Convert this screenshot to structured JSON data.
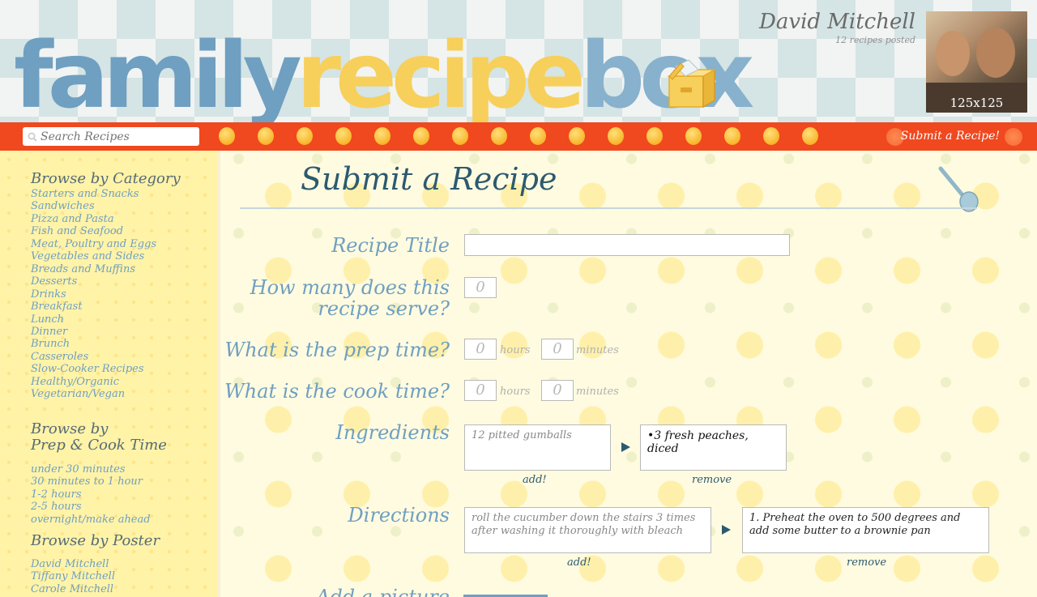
{
  "header": {
    "logo_family": "family",
    "logo_recipe": "recipe",
    "logo_box": "box",
    "username": "David Mitchell",
    "recipe_count": "12 recipes posted",
    "avatar_label": "125x125"
  },
  "navbar": {
    "search_placeholder": "Search Recipes",
    "search_dims": "218x23",
    "submit_link": "Submit a Recipe!"
  },
  "sidebar": {
    "category_title": "Browse by Category",
    "categories": [
      "Starters and Snacks",
      "Sandwiches",
      "Pizza and Pasta",
      "Fish and Seafood",
      "Meat, Poultry and Eggs",
      "Vegetables and Sides",
      "Breads and Muffins",
      "Desserts",
      "Drinks",
      "Breakfast",
      "Lunch",
      "Dinner",
      "Brunch",
      "Casseroles",
      "Slow-Cooker Recipes",
      "Healthy/Organic",
      "Vegetarian/Vegan"
    ],
    "time_title_1": "Browse by",
    "time_title_2": "Prep & Cook Time",
    "times": [
      "under 30 minutes",
      "30 minutes to 1 hour",
      "1-2 hours",
      "2-5 hours",
      "overnight/make ahead"
    ],
    "poster_title": "Browse by Poster",
    "posters": [
      "David Mitchell",
      "Tiffany Mitchell",
      "Carole Mitchell"
    ]
  },
  "form": {
    "page_title": "Submit a Recipe",
    "title_label": "Recipe Title",
    "serves_label_1": "How many does this",
    "serves_label_2": "recipe serve?",
    "serves_value": "0",
    "prep_label": "What is the prep time?",
    "cook_label": "What is the cook time?",
    "hours_value": "0",
    "minutes_value": "0",
    "hours_unit": "hours",
    "minutes_unit": "minutes",
    "ingredients_label": "Ingredients",
    "ingredient_input": "12 pitted gumballs",
    "ingredient_item": "•3 fresh peaches, diced",
    "directions_label": "Directions",
    "direction_input": "roll the cucumber down the stairs 3 times after washing it thoroughly with bleach",
    "direction_item": "1. Preheat the oven to 500 degrees and add some butter to a brownie pan",
    "add_label": "add!",
    "remove_label": "remove",
    "picture_label": "Add a picture"
  },
  "colors": {
    "accent_orange": "#f0481f",
    "heading_blue": "#2c5a70",
    "link_blue": "#6f9fc1",
    "sidebar_yellow": "#fff3a8"
  }
}
